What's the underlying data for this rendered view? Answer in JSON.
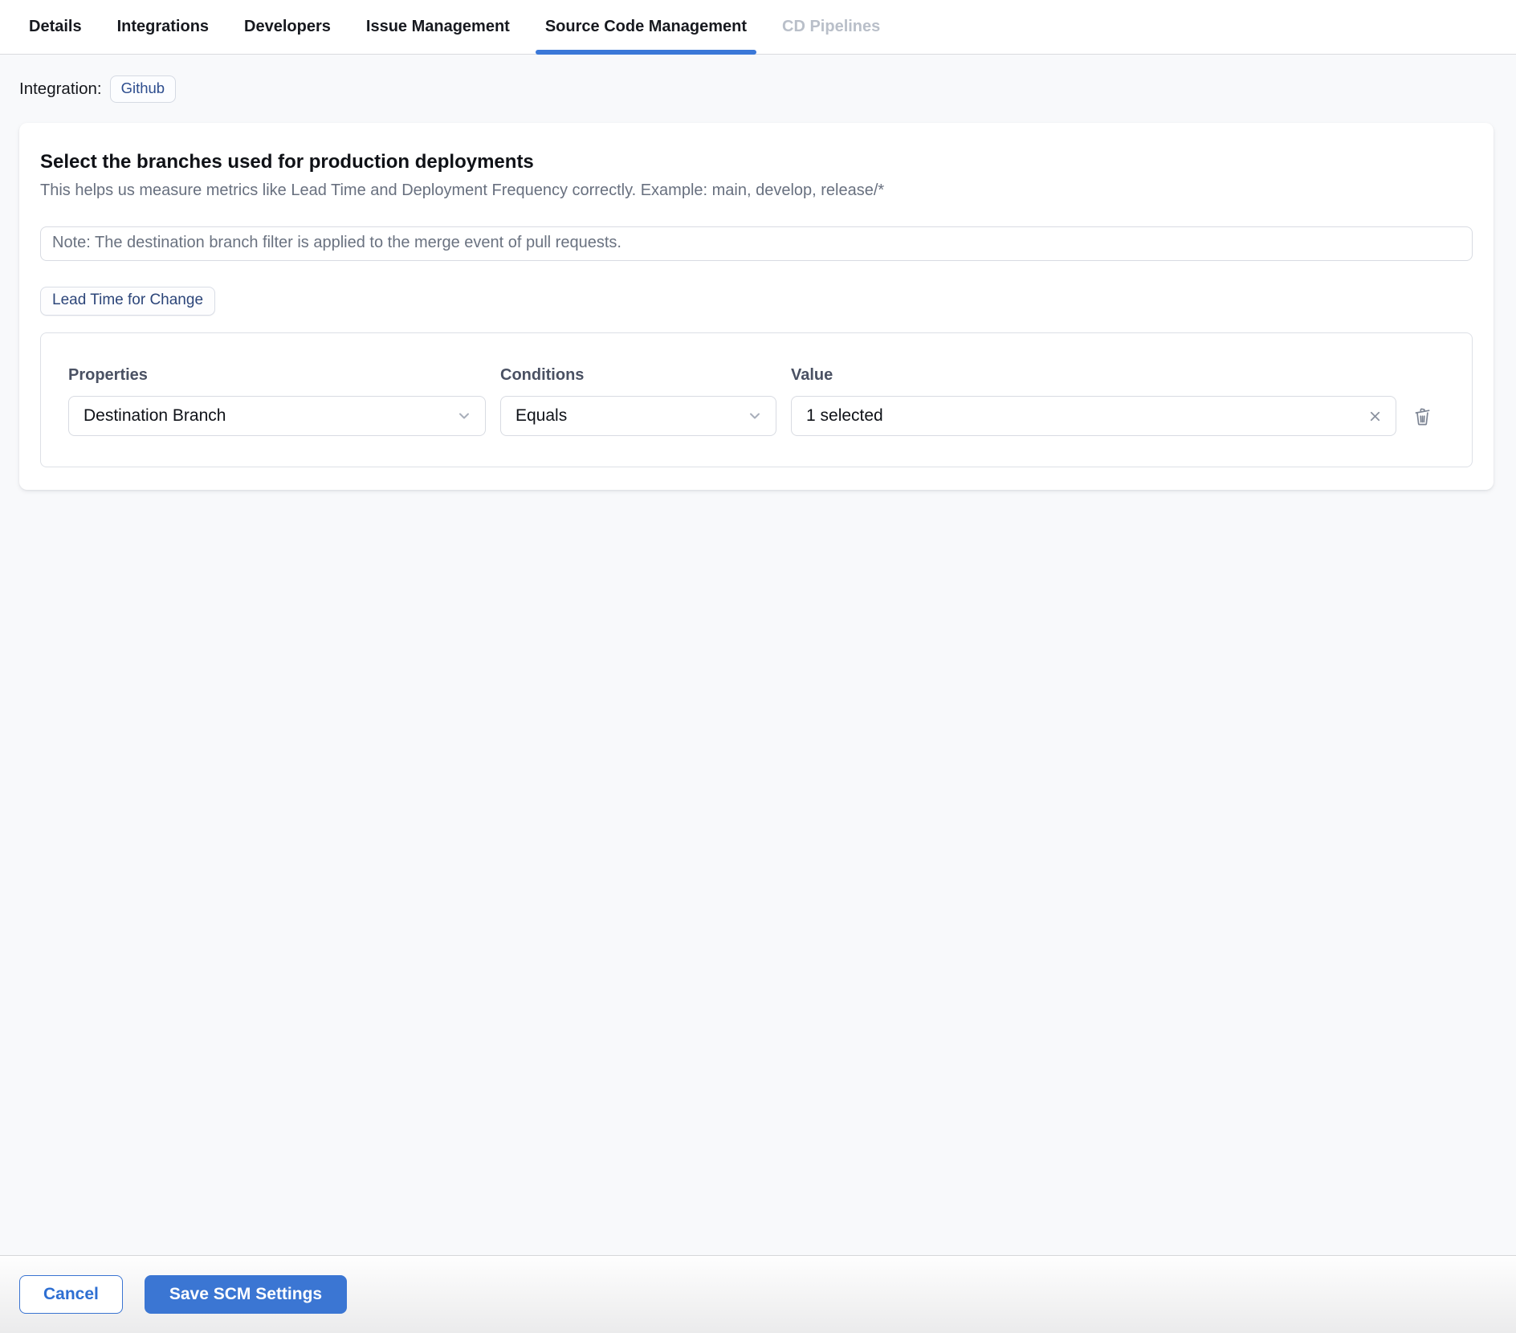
{
  "tabs": {
    "items": [
      {
        "label": "Details",
        "state": "default"
      },
      {
        "label": "Integrations",
        "state": "default"
      },
      {
        "label": "Developers",
        "state": "default"
      },
      {
        "label": "Issue Management",
        "state": "default"
      },
      {
        "label": "Source Code Management",
        "state": "active"
      },
      {
        "label": "CD Pipelines",
        "state": "disabled"
      }
    ]
  },
  "integration": {
    "label": "Integration:",
    "value": "Github"
  },
  "card": {
    "title": "Select the branches used for production deployments",
    "subtitle": "This helps us measure metrics like Lead Time and Deployment Frequency correctly. Example: main, develop, release/*",
    "note": "Note: The destination branch filter is applied to the merge event of pull requests.",
    "metric_tag": "Lead Time for Change",
    "filter": {
      "columns": {
        "properties": "Properties",
        "conditions": "Conditions",
        "value": "Value"
      },
      "row": {
        "property": "Destination Branch",
        "condition": "Equals",
        "value": "1 selected"
      }
    }
  },
  "footer": {
    "cancel_label": "Cancel",
    "save_label": "Save SCM Settings"
  },
  "colors": {
    "accent": "#3b76d3",
    "tab_underline": "#3b78d8",
    "badge_text": "#2d4d8e",
    "chip_text": "#2c4579",
    "page_background": "#f8f9fb"
  }
}
